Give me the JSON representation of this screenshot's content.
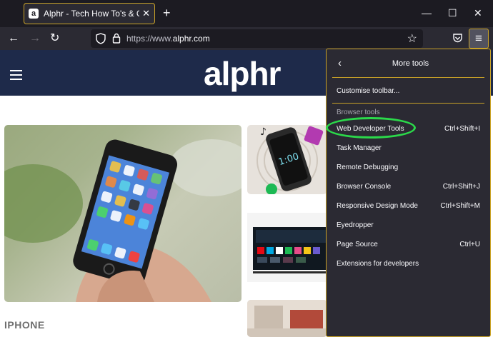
{
  "browser": {
    "tab": {
      "title": "Alphr - Tech How To's & Guides",
      "favicon": "a",
      "close_icon": "close-icon"
    },
    "new_tab_icon": "+",
    "window_controls": {
      "minimize": "—",
      "maximize": "☐",
      "close": "✕"
    },
    "nav": {
      "back_icon": "←",
      "forward_icon": "→",
      "reload_icon": "↻",
      "url_prefix": "https://www.",
      "url_domain": "alphr.com",
      "bookmark_icon": "☆",
      "pocket_icon": "pocket-icon",
      "menu_icon": "≡"
    }
  },
  "page": {
    "logo": "alphr",
    "category": "IPHONE"
  },
  "menu": {
    "back_icon": "‹",
    "title": "More tools",
    "customise": "Customise toolbar...",
    "section_label": "Browser tools",
    "items": [
      {
        "label": "Web Developer Tools",
        "shortcut": "Ctrl+Shift+I"
      },
      {
        "label": "Task Manager",
        "shortcut": ""
      },
      {
        "label": "Remote Debugging",
        "shortcut": ""
      },
      {
        "label": "Browser Console",
        "shortcut": "Ctrl+Shift+J"
      },
      {
        "label": "Responsive Design Mode",
        "shortcut": "Ctrl+Shift+M"
      },
      {
        "label": "Eyedropper",
        "shortcut": ""
      },
      {
        "label": "Page Source",
        "shortcut": "Ctrl+U"
      },
      {
        "label": "Extensions for developers",
        "shortcut": ""
      }
    ]
  },
  "colors": {
    "titlebar": "#1c1b22",
    "toolbar": "#2b2a33",
    "accent_border": "#c9a227",
    "highlight_ring": "#2bd94a",
    "site_header": "#1e2a4a"
  }
}
